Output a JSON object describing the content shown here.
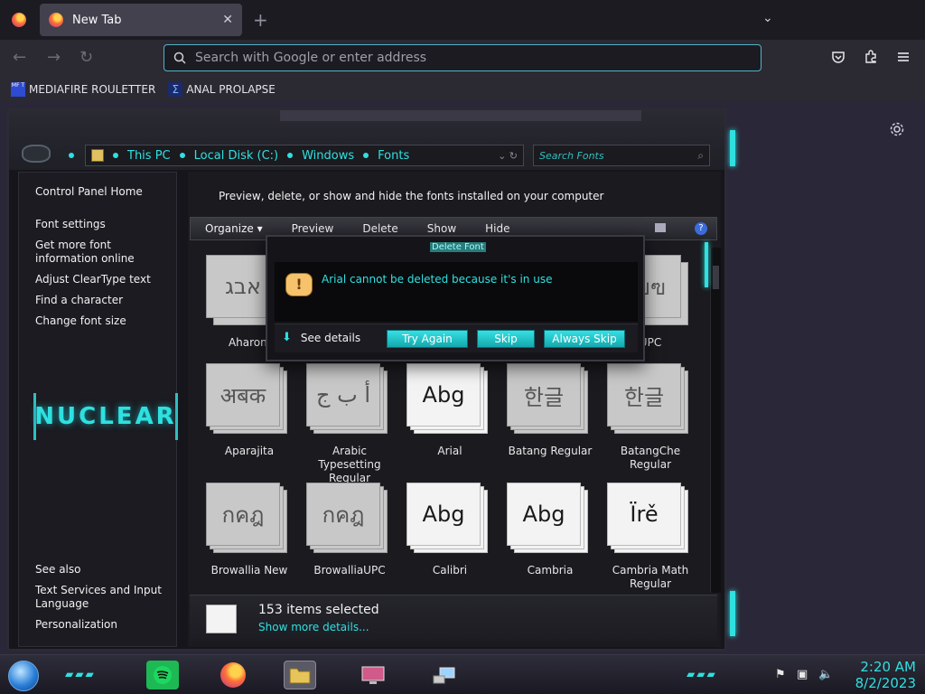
{
  "browser": {
    "tab_title": "New Tab",
    "tab_close": "✕",
    "new_tab": "+",
    "tab_list": "⌄",
    "nav_back": "←",
    "nav_forward": "→",
    "nav_reload": "↻",
    "url_placeholder": "Search with Google or enter address",
    "bookmarks": [
      {
        "label": "MEDIAFIRE ROULETTER",
        "icon_text": "MF T"
      },
      {
        "label": "ANAL PROLAPSE",
        "icon_text": "Σ"
      }
    ]
  },
  "explorer": {
    "breadcrumb": [
      "This PC",
      "Local Disk (C:)",
      "Windows",
      "Fonts"
    ],
    "addr_tail": "⌄ ↻",
    "search_placeholder": "Search Fonts",
    "left_pane": {
      "links": [
        "Control Panel Home",
        "Font settings",
        "Get more font information online",
        "Adjust ClearType text",
        "Find a character",
        "Change font size"
      ],
      "logo_text": "NUCLEAR",
      "see_also_label": "See also",
      "see_also": [
        "Text Services and Input Language",
        "Personalization"
      ]
    },
    "description": "Preview, delete, or show and hide the fonts installed on your computer",
    "toolbar": [
      "Organize ▾",
      "Preview",
      "Delete",
      "Show",
      "Hide"
    ],
    "help": "?",
    "fonts_row0": [
      {
        "name": "Aharoni",
        "sample": "אבג"
      },
      {
        "name": "UPC",
        "sample": "กขฃ"
      }
    ],
    "fonts": [
      {
        "name": "Aparajita",
        "sample": "अबक",
        "bright": false
      },
      {
        "name": "Arabic Typesetting Regular",
        "sample": "أ ب ج",
        "bright": false
      },
      {
        "name": "Arial",
        "sample": "Abg",
        "bright": true
      },
      {
        "name": "Batang Regular",
        "sample": "한글",
        "bright": false
      },
      {
        "name": "BatangChe Regular",
        "sample": "한글",
        "bright": false
      },
      {
        "name": "Browallia New",
        "sample": "กคฎ",
        "bright": false
      },
      {
        "name": "BrowalliaUPC",
        "sample": "กคฎ",
        "bright": false
      },
      {
        "name": "Calibri",
        "sample": "Abg",
        "bright": true
      },
      {
        "name": "Cambria",
        "sample": "Abg",
        "bright": true
      },
      {
        "name": "Cambria Math Regular",
        "sample": "Ïrě",
        "bright": true
      }
    ],
    "details": {
      "count": "153 items selected",
      "more": "Show more details..."
    }
  },
  "dialog": {
    "title": "Delete Font",
    "icon_text": "!",
    "message": "Arial cannot be deleted because it's in use",
    "see_details": "See details",
    "buttons": [
      "Try Again",
      "Skip",
      "Always Skip"
    ]
  },
  "taskbar": {
    "time": "2:20 AM",
    "date": "8/2/2023"
  },
  "colors": {
    "accent": "#2fe0e0",
    "url_border": "#53b3c7"
  }
}
